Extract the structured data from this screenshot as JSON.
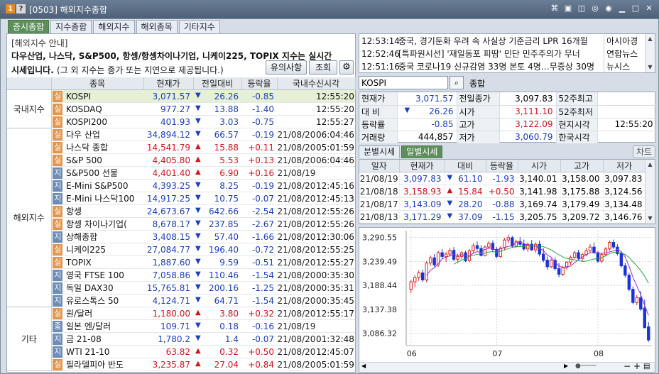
{
  "window": {
    "badge_num": "1",
    "badge_help": "?",
    "title": "[0503] 해외지수종합",
    "tools": [
      "⌘",
      "▣",
      "◫",
      "◎",
      "◉",
      "▁",
      "□",
      "✕"
    ]
  },
  "tabs": [
    "증시종합",
    "지수종합",
    "해외지수",
    "해외종목",
    "기타지수"
  ],
  "info": {
    "title": "[해외지수 안내]",
    "line1": "다우산업, 나스닥, S&P500, 항셍/항셍차이나기업, 니케이225, TOPIX 지수는 실시간",
    "line2": "시세입니다.",
    "note": "(그 외 지수는 종가 또는 지연으로 제공됩니다.)",
    "btn_caution": "유의사항",
    "btn_query": "조회",
    "btn_settings_icon": "gear-icon"
  },
  "table": {
    "headers": [
      "종목",
      "현재가",
      "전일대비",
      "등락율",
      "국내수신시각"
    ],
    "groups": [
      {
        "name": "국내지수",
        "rows": [
          {
            "badge": "실",
            "name": "KOSPI",
            "price": "3,071.57",
            "dir": "down",
            "change": "26.26",
            "rate": "-0.85",
            "date": "",
            "time": "12:55:20",
            "hl": true
          },
          {
            "badge": "실",
            "name": "KOSDAQ",
            "price": "977.27",
            "dir": "down",
            "change": "13.88",
            "rate": "-1.40",
            "date": "",
            "time": "12:55:20",
            "hl": false
          },
          {
            "badge": "실",
            "name": "KOSPI200",
            "price": "401.93",
            "dir": "down",
            "change": "3.03",
            "rate": "-0.75",
            "date": "",
            "time": "12:55:27",
            "hl": false
          }
        ]
      },
      {
        "name": "해외지수",
        "rows": [
          {
            "badge": "실",
            "name": "다우 산업",
            "price": "34,894.12",
            "dir": "down",
            "change": "66.57",
            "rate": "-0.19",
            "date": "21/08/20",
            "time": "06:04:46"
          },
          {
            "badge": "실",
            "name": "나스닥 종합",
            "price": "14,541.79",
            "dir": "up",
            "change": "15.88",
            "rate": "+0.11",
            "date": "21/08/20",
            "time": "05:01:59"
          },
          {
            "badge": "실",
            "name": "S&P 500",
            "price": "4,405.80",
            "dir": "up",
            "change": "5.53",
            "rate": "+0.13",
            "date": "21/08/20",
            "time": "06:04:46"
          },
          {
            "badge": "지",
            "name": "S&P500 선물",
            "price": "4,401.40",
            "dir": "up",
            "change": "6.90",
            "rate": "+0.16",
            "date": "21/08/19",
            "time": ""
          },
          {
            "badge": "지",
            "name": "E-Mini S&P500",
            "price": "4,393.25",
            "dir": "down",
            "change": "8.25",
            "rate": "-0.19",
            "date": "21/08/20",
            "time": "12:45:16"
          },
          {
            "badge": "지",
            "name": "E-Mini 나스닥100",
            "price": "14,917.25",
            "dir": "down",
            "change": "10.75",
            "rate": "-0.07",
            "date": "21/08/20",
            "time": "12:45:13"
          },
          {
            "badge": "실",
            "name": "항셍",
            "price": "24,673.67",
            "dir": "down",
            "change": "642.66",
            "rate": "-2.54",
            "date": "21/08/20",
            "time": "12:55:26"
          },
          {
            "badge": "실",
            "name": "항셍 차이나기업(",
            "price": "8,678.17",
            "dir": "down",
            "change": "237.85",
            "rate": "-2.67",
            "date": "21/08/20",
            "time": "12:55:26"
          },
          {
            "badge": "지",
            "name": "상해종합",
            "price": "3,408.15",
            "dir": "down",
            "change": "57.40",
            "rate": "-1.66",
            "date": "21/08/20",
            "time": "12:30:06"
          },
          {
            "badge": "실",
            "name": "니케이225",
            "price": "27,084.77",
            "dir": "down",
            "change": "196.40",
            "rate": "-0.72",
            "date": "21/08/20",
            "time": "12:55:25"
          },
          {
            "badge": "실",
            "name": "TOPIX",
            "price": "1,887.60",
            "dir": "down",
            "change": "9.59",
            "rate": "-0.51",
            "date": "21/08/20",
            "time": "12:55:27"
          },
          {
            "badge": "지",
            "name": "영국 FTSE 100",
            "price": "7,058.86",
            "dir": "down",
            "change": "110.46",
            "rate": "-1.54",
            "date": "21/08/20",
            "time": "00:35:30"
          },
          {
            "badge": "지",
            "name": "독일 DAX30",
            "price": "15,765.81",
            "dir": "down",
            "change": "200.16",
            "rate": "-1.25",
            "date": "21/08/20",
            "time": "00:35:31"
          },
          {
            "badge": "지",
            "name": "유로스톡스 50",
            "price": "4,124.71",
            "dir": "down",
            "change": "64.71",
            "rate": "-1.54",
            "date": "21/08/20",
            "time": "00:35:45"
          }
        ]
      },
      {
        "name": "기타",
        "rows": [
          {
            "badge": "실",
            "name": "원/달러",
            "price": "1,180.00",
            "dir": "up",
            "change": "3.80",
            "rate": "+0.32",
            "date": "21/08/20",
            "time": "12:55:17"
          },
          {
            "badge": "종",
            "name": "일본 엔/달러",
            "price": "109.71",
            "dir": "down",
            "change": "0.18",
            "rate": "-0.16",
            "date": "21/08/19",
            "time": ""
          },
          {
            "badge": "지",
            "name": "금 21-08",
            "price": "1,780.2",
            "dir": "down",
            "change": "1.4",
            "rate": "-0.07",
            "date": "21/08/20",
            "time": "01:32:48"
          },
          {
            "badge": "지",
            "name": "WTI 21-10",
            "price": "63.82",
            "dir": "up",
            "change": "0.32",
            "rate": "+0.50",
            "date": "21/08/20",
            "time": "12:45:07"
          },
          {
            "badge": "실",
            "name": "필라델피아 반도",
            "price": "3,235.87",
            "dir": "up",
            "change": "27.04",
            "rate": "+0.84",
            "date": "21/08/20",
            "time": "05:01:59"
          }
        ]
      }
    ]
  },
  "news": [
    {
      "time": "12:53:14",
      "headline": "중국, 경기둔화 우려 속 사실상 기준금리 LPR 16개월",
      "source": "아시아경"
    },
    {
      "time": "12:52:46",
      "headline": "[특파원시선] '재일동포 피땀' 민단 민주주의가 무너",
      "source": "연합뉴스"
    },
    {
      "time": "12:51:16",
      "headline": "중국 코로나19 신규감염 33명 본토 4명…무증상 30명",
      "source": "뉴시스"
    }
  ],
  "search": {
    "value": "KOSPI",
    "name": "종합",
    "icon": "search-icon"
  },
  "quote": {
    "current_label": "현재가",
    "current": "3,071.57",
    "prev_close_label": "전일종가",
    "prev_close": "3,097.83",
    "high52_label": "52주최고",
    "high52": "",
    "change_label": "대  비",
    "change": "26.26",
    "open_label": "시가",
    "open": "3,111.10",
    "low52_label": "52주최저",
    "low52": "",
    "rate_label": "등락률",
    "rate": "-0.85",
    "high_label": "고가",
    "high": "3,122.09",
    "local_time_label": "현지시각",
    "local_time": "12:55:20",
    "volume_label": "거래량",
    "volume": "444,857",
    "low_label": "저가",
    "low": "3,060.79",
    "korea_time_label": "한국시각",
    "korea_time": ""
  },
  "subtabs": [
    "분별시세",
    "일별시세"
  ],
  "chart_button": "차트",
  "daily": {
    "headers": [
      "일자",
      "현재가",
      "대비",
      "등락율",
      "시가",
      "고가",
      "저가"
    ],
    "rows": [
      {
        "date": "21/08/19",
        "price": "3,097.83",
        "dir": "down",
        "change": "61.10",
        "rate": "-1.93",
        "open": "3,140.01",
        "high": "3,158.00",
        "low": "3,097.83"
      },
      {
        "date": "21/08/18",
        "price": "3,158.93",
        "dir": "up",
        "change": "15.84",
        "rate": "+0.50",
        "open": "3,141.98",
        "high": "3,175.88",
        "low": "3,124.56"
      },
      {
        "date": "21/08/17",
        "price": "3,143.09",
        "dir": "down",
        "change": "28.20",
        "rate": "-0.88",
        "open": "3,169.74",
        "high": "3,179.49",
        "low": "3,134.48"
      },
      {
        "date": "21/08/13",
        "price": "3,171.29",
        "dir": "down",
        "change": "37.09",
        "rate": "-1.15",
        "open": "3,205.75",
        "high": "3,209.72",
        "low": "3,146.76"
      }
    ]
  },
  "chart_data": {
    "type": "candlestick",
    "y_ticks": [
      "3,290.55",
      "3,239.49",
      "3,188.44",
      "3,137.38",
      "3,086.32"
    ],
    "y_tick_values": [
      3290.55,
      3239.49,
      3188.44,
      3137.38,
      3086.32
    ],
    "x_ticks": [
      "06",
      "07",
      "08"
    ],
    "ylim": [
      3060,
      3305
    ],
    "colors": {
      "up": "#e0241b",
      "down": "#1a33d8",
      "ma_short": "#9c2bd1",
      "ma_long": "#23a63a"
    },
    "candles": [
      [
        3180,
        3200,
        3172,
        3196
      ],
      [
        3196,
        3210,
        3185,
        3205
      ],
      [
        3205,
        3220,
        3198,
        3215
      ],
      [
        3215,
        3222,
        3196,
        3200
      ],
      [
        3200,
        3240,
        3195,
        3236
      ],
      [
        3236,
        3252,
        3230,
        3247
      ],
      [
        3247,
        3255,
        3228,
        3232
      ],
      [
        3232,
        3262,
        3228,
        3258
      ],
      [
        3258,
        3266,
        3245,
        3250
      ],
      [
        3250,
        3260,
        3238,
        3255
      ],
      [
        3255,
        3268,
        3250,
        3263
      ],
      [
        3263,
        3270,
        3240,
        3244
      ],
      [
        3244,
        3256,
        3236,
        3250
      ],
      [
        3250,
        3262,
        3244,
        3258
      ],
      [
        3258,
        3262,
        3238,
        3241
      ],
      [
        3241,
        3266,
        3238,
        3262
      ],
      [
        3262,
        3278,
        3258,
        3273
      ],
      [
        3273,
        3282,
        3262,
        3267
      ],
      [
        3267,
        3274,
        3250,
        3252
      ],
      [
        3252,
        3274,
        3250,
        3270
      ],
      [
        3270,
        3283,
        3266,
        3278
      ],
      [
        3278,
        3284,
        3260,
        3265
      ],
      [
        3265,
        3270,
        3246,
        3250
      ],
      [
        3250,
        3272,
        3247,
        3268
      ],
      [
        3268,
        3290,
        3263,
        3285
      ],
      [
        3285,
        3296,
        3278,
        3290
      ],
      [
        3290,
        3294,
        3268,
        3272
      ],
      [
        3272,
        3286,
        3268,
        3282
      ],
      [
        3282,
        3291,
        3272,
        3276
      ],
      [
        3276,
        3286,
        3262,
        3266
      ],
      [
        3266,
        3280,
        3260,
        3276
      ],
      [
        3276,
        3285,
        3262,
        3264
      ],
      [
        3264,
        3280,
        3258,
        3276
      ],
      [
        3276,
        3284,
        3250,
        3255
      ],
      [
        3255,
        3268,
        3238,
        3242
      ],
      [
        3242,
        3250,
        3222,
        3228
      ],
      [
        3228,
        3246,
        3225,
        3242
      ],
      [
        3242,
        3248,
        3220,
        3224
      ],
      [
        3224,
        3236,
        3206,
        3212
      ],
      [
        3212,
        3230,
        3208,
        3226
      ],
      [
        3226,
        3240,
        3222,
        3238
      ],
      [
        3238,
        3252,
        3232,
        3248
      ],
      [
        3248,
        3262,
        3245,
        3258
      ],
      [
        3258,
        3264,
        3242,
        3246
      ],
      [
        3246,
        3258,
        3240,
        3254
      ],
      [
        3254,
        3268,
        3250,
        3262
      ],
      [
        3262,
        3276,
        3258,
        3270
      ],
      [
        3270,
        3280,
        3256,
        3258
      ],
      [
        3258,
        3262,
        3236,
        3240
      ],
      [
        3240,
        3258,
        3236,
        3254
      ],
      [
        3254,
        3270,
        3250,
        3266
      ],
      [
        3266,
        3284,
        3262,
        3280
      ],
      [
        3280,
        3286,
        3266,
        3270
      ],
      [
        3270,
        3276,
        3252,
        3256
      ],
      [
        3256,
        3260,
        3226,
        3230
      ],
      [
        3230,
        3236,
        3205,
        3210
      ],
      [
        3210,
        3215,
        3176,
        3180
      ],
      [
        3180,
        3186,
        3148,
        3152
      ],
      [
        3152,
        3168,
        3146,
        3162
      ],
      [
        3162,
        3176,
        3134,
        3138
      ],
      [
        3140,
        3158,
        3098,
        3098
      ],
      [
        3100,
        3110,
        3068,
        3072
      ]
    ]
  }
}
